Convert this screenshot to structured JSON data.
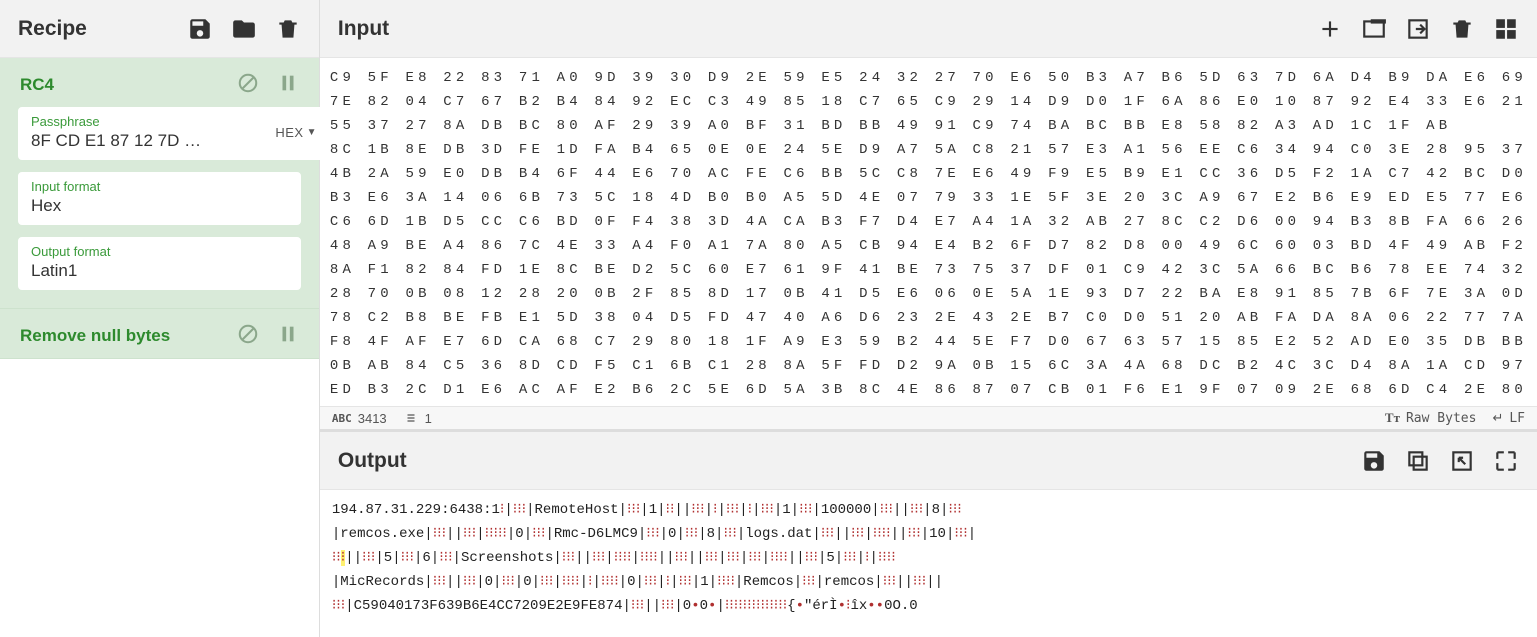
{
  "recipe": {
    "title": "Recipe",
    "operations": [
      {
        "name": "RC4",
        "fields": {
          "passphrase": {
            "label": "Passphrase",
            "value": "8F CD E1 87 12 7D …",
            "type_toggle": "HEX"
          },
          "input_format": {
            "label": "Input format",
            "value": "Hex"
          },
          "output_format": {
            "label": "Output format",
            "value": "Latin1"
          }
        }
      },
      {
        "name": "Remove null bytes"
      }
    ]
  },
  "input": {
    "title": "Input",
    "lines": [
      "C9 5F E8 22 83 71 A0 9D 39 30 D9 2E 59 E5 24 32 27 70 E6 50 B3 A7 B6 5D 63 7D 6A D4 B9 DA E6 69",
      "7E 82 04 C7 67 B2 B4 84 92 EC C3 49 85 18 C7 65 C9 29 14 D9 D0 1F 6A 86 E0 10 87 92 E4 33 E6 21",
      "55 37 27 8A DB BC 80 AF 29 39 A0 BF 31 BD BB 49 91 C9 74 BA BC BB E8 58 82 A3 AD 1C 1F AB",
      "8C 1B 8E DB 3D FE 1D FA B4 65 0E 0E 24 5E D9 A7 5A C8 21 57 E3 A1 56 EE C6 34 94 C0 3E 28 95 37",
      "4B 2A 59 E0 DB B4 6F 44 E6 70 AC FE C6 BB 5C C8 7E E6 49 F9 E5 B9 E1 CC 36 D5 F2 1A C7 42 BC D0",
      "B3 E6 3A 14 06 6B 73 5C 18 4D B0 B0 A5 5D 4E 07 79 33 1E 5F 3E 20 3C A9 67 E2 B6 E9 ED E5 77 E6",
      "C6 6D 1B D5 CC C6 BD 0F F4 38 3D 4A CA B3 F7 D4 E7 A4 1A 32 AB 27 8C C2 D6 00 94 B3 8B FA 66 26",
      "48 A9 BE A4 86 7C 4E 33 A4 F0 A1 7A 80 A5 CB 94 E4 B2 6F D7 82 D8 00 49 6C 60 03 BD 4F 49 AB F2",
      "8A F1 82 84 FD 1E 8C BE D2 5C 60 E7 61 9F 41 BE 73 75 37 DF 01 C9 42 3C 5A 66 BC B6 78 EE 74 32",
      "28 70 0B 08 12 28 20 0B 2F 85 8D 17 0B 41 D5 E6 06 0E 5A 1E 93 D7 22 BA E8 91 85 7B 6F 7E 3A 0D",
      "78 C2 B8 BE FB E1 5D 38 04 D5 FD 47 40 A6 D6 23 2E 43 2E B7 C0 D0 51 20 AB FA DA 8A 06 22 77 7A",
      "F8 4F AF E7 6D CA 68 C7 29 80 18 1F A9 E3 59 B2 44 5E F7 D0 67 63 57 15 85 E2 52 AD E0 35 DB BB",
      "0B AB 84 C5 36 8D CD F5 C1 6B C1 28 8A 5F FD D2 9A 0B 15 6C 3A 4A 68 DC B2 4C 3C D4 8A 1A CD 97",
      "ED B3 2C D1 E6 AC AF E2 B6 2C 5E 6D 5A 3B 8C 4E 86 87 07 CB 01 F6 E1 9F 07 09 2E 68 6D C4 2E 80"
    ],
    "status": {
      "chars": "3413",
      "lines": "1",
      "encoding": "Raw Bytes",
      "eol": "LF"
    }
  },
  "output": {
    "title": "Output",
    "text_segments": [
      {
        "t": "194.87.31.229:6438:1"
      },
      {
        "r": "⁝"
      },
      {
        "t": "|"
      },
      {
        "r": "⁝⁝⁝"
      },
      {
        "t": "|RemoteHost|"
      },
      {
        "r": "⁝⁝⁝"
      },
      {
        "t": "|1|"
      },
      {
        "r": "⁝⁝"
      },
      {
        "t": "||"
      },
      {
        "r": "⁝⁝⁝"
      },
      {
        "t": "|"
      },
      {
        "r": "⁝"
      },
      {
        "t": "|"
      },
      {
        "r": "⁝⁝⁝"
      },
      {
        "t": "|"
      },
      {
        "r": "⁝"
      },
      {
        "t": "|"
      },
      {
        "r": "⁝⁝⁝"
      },
      {
        "t": "|1|"
      },
      {
        "r": "⁝⁝⁝"
      },
      {
        "t": "|100000|"
      },
      {
        "r": "⁝⁝⁝"
      },
      {
        "t": "||"
      },
      {
        "r": "⁝⁝⁝"
      },
      {
        "t": "|8|"
      },
      {
        "r": "⁝⁝⁝"
      },
      {
        "nl": 1
      },
      {
        "t": "|remcos.exe|"
      },
      {
        "r": "⁝⁝⁝"
      },
      {
        "t": "||"
      },
      {
        "r": "⁝⁝⁝"
      },
      {
        "t": "|"
      },
      {
        "r": "⁝⁝⁝⁝⁝"
      },
      {
        "t": "|0|"
      },
      {
        "r": "⁝⁝⁝"
      },
      {
        "t": "|Rmc-D6LMC9|"
      },
      {
        "r": "⁝⁝⁝"
      },
      {
        "t": "|0|"
      },
      {
        "r": "⁝⁝⁝"
      },
      {
        "t": "|8|"
      },
      {
        "r": "⁝⁝⁝"
      },
      {
        "t": "|logs.dat|"
      },
      {
        "r": "⁝⁝⁝"
      },
      {
        "t": "||"
      },
      {
        "r": "⁝⁝⁝"
      },
      {
        "t": "|"
      },
      {
        "r": "⁝⁝⁝⁝"
      },
      {
        "t": "||"
      },
      {
        "r": "⁝⁝⁝"
      },
      {
        "t": "|10|"
      },
      {
        "r": "⁝⁝⁝"
      },
      {
        "t": "|"
      },
      {
        "nl": 1
      },
      {
        "r": "⁝⁝"
      },
      {
        "hl": "⁝"
      },
      {
        "t": "||"
      },
      {
        "r": "⁝⁝⁝"
      },
      {
        "t": "|5|"
      },
      {
        "r": "⁝⁝⁝"
      },
      {
        "t": "|6|"
      },
      {
        "r": "⁝⁝⁝"
      },
      {
        "t": "|Screenshots|"
      },
      {
        "r": "⁝⁝⁝"
      },
      {
        "t": "||"
      },
      {
        "r": "⁝⁝⁝"
      },
      {
        "t": "|"
      },
      {
        "r": "⁝⁝⁝⁝"
      },
      {
        "t": "|"
      },
      {
        "r": "⁝⁝⁝⁝"
      },
      {
        "t": "||"
      },
      {
        "r": "⁝⁝⁝"
      },
      {
        "t": "||"
      },
      {
        "r": "⁝⁝⁝"
      },
      {
        "t": "|"
      },
      {
        "r": "⁝⁝⁝"
      },
      {
        "t": "|"
      },
      {
        "r": "⁝⁝⁝"
      },
      {
        "t": "|"
      },
      {
        "r": "⁝⁝⁝⁝"
      },
      {
        "t": "||"
      },
      {
        "r": "⁝⁝⁝"
      },
      {
        "t": "|5|"
      },
      {
        "r": "⁝⁝⁝"
      },
      {
        "t": "|"
      },
      {
        "r": "⁝"
      },
      {
        "t": "|"
      },
      {
        "r": "⁝⁝⁝⁝"
      },
      {
        "nl": 1
      },
      {
        "t": "|MicRecords|"
      },
      {
        "r": "⁝⁝⁝"
      },
      {
        "t": "||"
      },
      {
        "r": "⁝⁝⁝"
      },
      {
        "t": "|0|"
      },
      {
        "r": "⁝⁝⁝"
      },
      {
        "t": "|0|"
      },
      {
        "r": "⁝⁝⁝"
      },
      {
        "t": "|"
      },
      {
        "r": "⁝⁝⁝⁝"
      },
      {
        "t": "|"
      },
      {
        "r": "⁝"
      },
      {
        "t": "|"
      },
      {
        "r": "⁝⁝⁝⁝"
      },
      {
        "t": "|0|"
      },
      {
        "r": "⁝⁝⁝"
      },
      {
        "t": "|"
      },
      {
        "r": "⁝"
      },
      {
        "t": "|"
      },
      {
        "r": "⁝⁝⁝"
      },
      {
        "t": "|1|"
      },
      {
        "r": "⁝⁝⁝⁝"
      },
      {
        "t": "|Remcos|"
      },
      {
        "r": "⁝⁝⁝"
      },
      {
        "t": "|remcos|"
      },
      {
        "r": "⁝⁝⁝"
      },
      {
        "t": "||"
      },
      {
        "r": "⁝⁝⁝"
      },
      {
        "t": "||"
      },
      {
        "nl": 1
      },
      {
        "r": "⁝⁝⁝"
      },
      {
        "t": "|C59040173F639B6E4CC7209E2E9FE874|"
      },
      {
        "r": "⁝⁝⁝"
      },
      {
        "t": "||"
      },
      {
        "r": "⁝⁝⁝"
      },
      {
        "t": "|0"
      },
      {
        "r": "•"
      },
      {
        "t": "0"
      },
      {
        "r": "•"
      },
      {
        "t": "|"
      },
      {
        "r": "⁝⁝⁝⁝⁝⁝⁝⁝⁝⁝⁝⁝⁝⁝"
      },
      {
        "t": "{"
      },
      {
        "r": "•"
      },
      {
        "t": "\"érÌ"
      },
      {
        "r": "•"
      },
      {
        "t": ""
      },
      {
        "r": "⁝"
      },
      {
        "t": "îx"
      },
      {
        "r": "••"
      },
      {
        "t": "0O.0"
      }
    ]
  }
}
